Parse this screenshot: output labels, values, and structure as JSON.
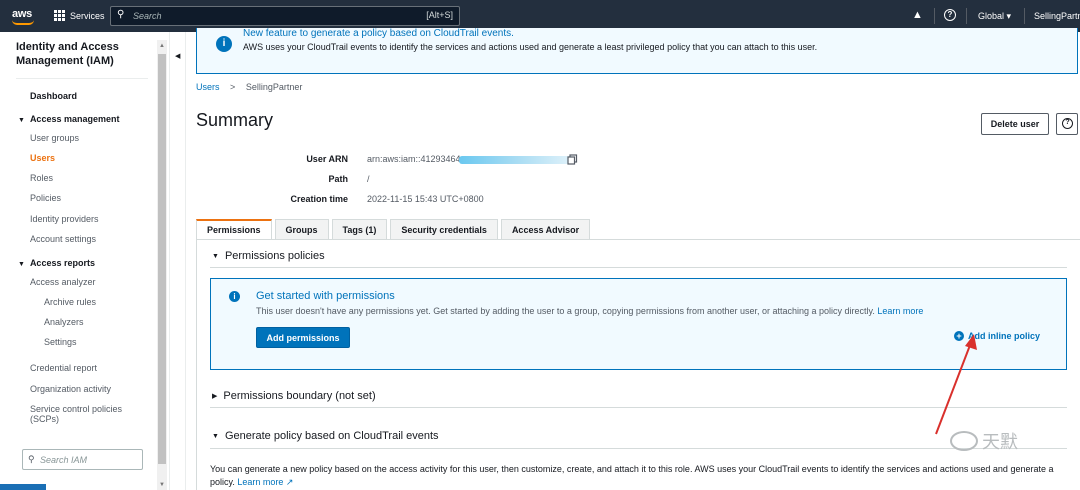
{
  "topbar": {
    "logo": "aws",
    "services_label": "Services",
    "search_placeholder": "Search",
    "search_shortcut": "[Alt+S]",
    "region": "Global ▾",
    "account": "SellingPartne"
  },
  "sidebar": {
    "title": "Identity and Access Management (IAM)",
    "dashboard": "Dashboard",
    "access_management": "Access management",
    "user_groups": "User groups",
    "users": "Users",
    "roles": "Roles",
    "policies": "Policies",
    "identity_providers": "Identity providers",
    "account_settings": "Account settings",
    "access_reports": "Access reports",
    "access_analyzer": "Access analyzer",
    "archive_rules": "Archive rules",
    "analyzers": "Analyzers",
    "settings": "Settings",
    "credential_report": "Credential report",
    "organization_activity": "Organization activity",
    "scp_line1": "Service control policies",
    "scp_line2": "(SCPs)",
    "search_placeholder": "Search IAM"
  },
  "banner": {
    "heading": "New feature to generate a policy based on CloudTrail events.",
    "body": "AWS uses your CloudTrail events to identify the services and actions used and generate a least privileged policy that you can attach to this user."
  },
  "breadcrumb": {
    "users": "Users",
    "separator": ">",
    "current": "SellingPartner"
  },
  "summary": {
    "title": "Summary",
    "delete_button": "Delete user",
    "help_button": "?",
    "user_arn_label": "User ARN",
    "user_arn_value": "arn:aws:iam::41293464",
    "path_label": "Path",
    "path_value": "/",
    "creation_time_label": "Creation time",
    "creation_time_value": "2022-11-15 15:43 UTC+0800"
  },
  "tabs": [
    "Permissions",
    "Groups",
    "Tags (1)",
    "Security credentials",
    "Access Advisor"
  ],
  "permissions": {
    "policies_heading": "Permissions policies",
    "info_heading": "Get started with permissions",
    "info_body": "This user doesn't have any permissions yet. Get started by adding the user to a group, copying permissions from another user, or attaching a policy directly.",
    "learn_more": "Learn more",
    "add_permissions": "Add permissions",
    "add_inline_policy": "Add inline policy",
    "boundary_heading": "Permissions boundary (not set)",
    "generate_heading": "Generate policy based on CloudTrail events",
    "generate_text": "You can generate a new policy based on the access activity for this user, then customize, create, and attach it to this role. AWS uses your CloudTrail events to identify the services and actions used and generate a policy.",
    "generate_learn_more": "Learn more"
  },
  "watermark": "天默",
  "colors": {
    "topbar": "#232f3e",
    "accent_orange": "#ec7211",
    "link_blue": "#0073bb",
    "annotation_red": "#d9302c"
  }
}
